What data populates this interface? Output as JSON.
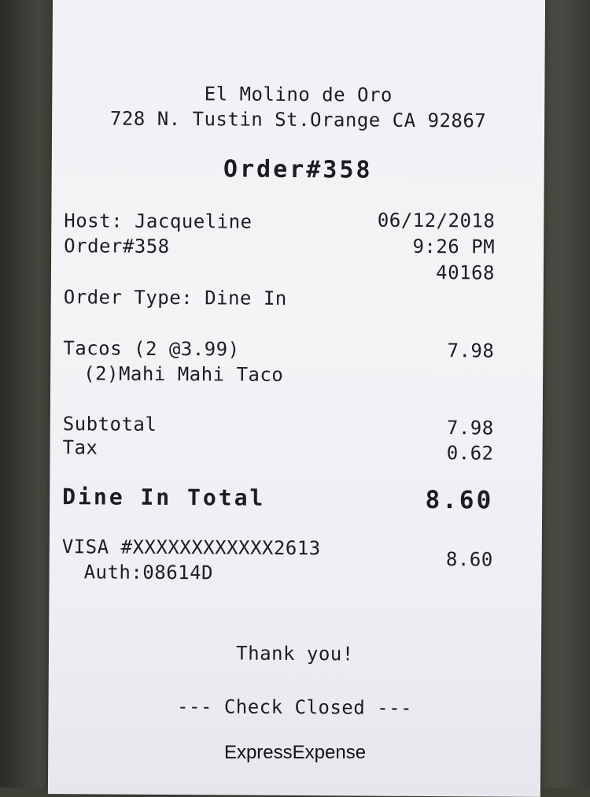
{
  "store": {
    "name": "El Molino de Oro",
    "address": "728 N. Tustin St.Orange CA 92867"
  },
  "order_heading": "Order#358",
  "info": {
    "host": "Host: Jacqueline",
    "order": "Order#358",
    "order_type": "Order Type:  Dine In",
    "date": "06/12/2018",
    "time": "9:26 PM",
    "number": "40168"
  },
  "items": [
    {
      "name": "Tacos (2 @3.99)",
      "detail": "(2)Mahi Mahi Taco",
      "amount": "7.98"
    }
  ],
  "totals": {
    "subtotal_label": "Subtotal",
    "subtotal_value": "7.98",
    "tax_label": "Tax",
    "tax_value": "0.62",
    "total_label": "Dine In Total",
    "total_value": "8.60"
  },
  "payment": {
    "card": "VISA #XXXXXXXXXXXX2613",
    "auth": "Auth:08614D",
    "amount": "8.60"
  },
  "footer": {
    "thanks": "Thank you!",
    "closed": "--- Check Closed ---"
  },
  "watermark": "ExpressExpense"
}
